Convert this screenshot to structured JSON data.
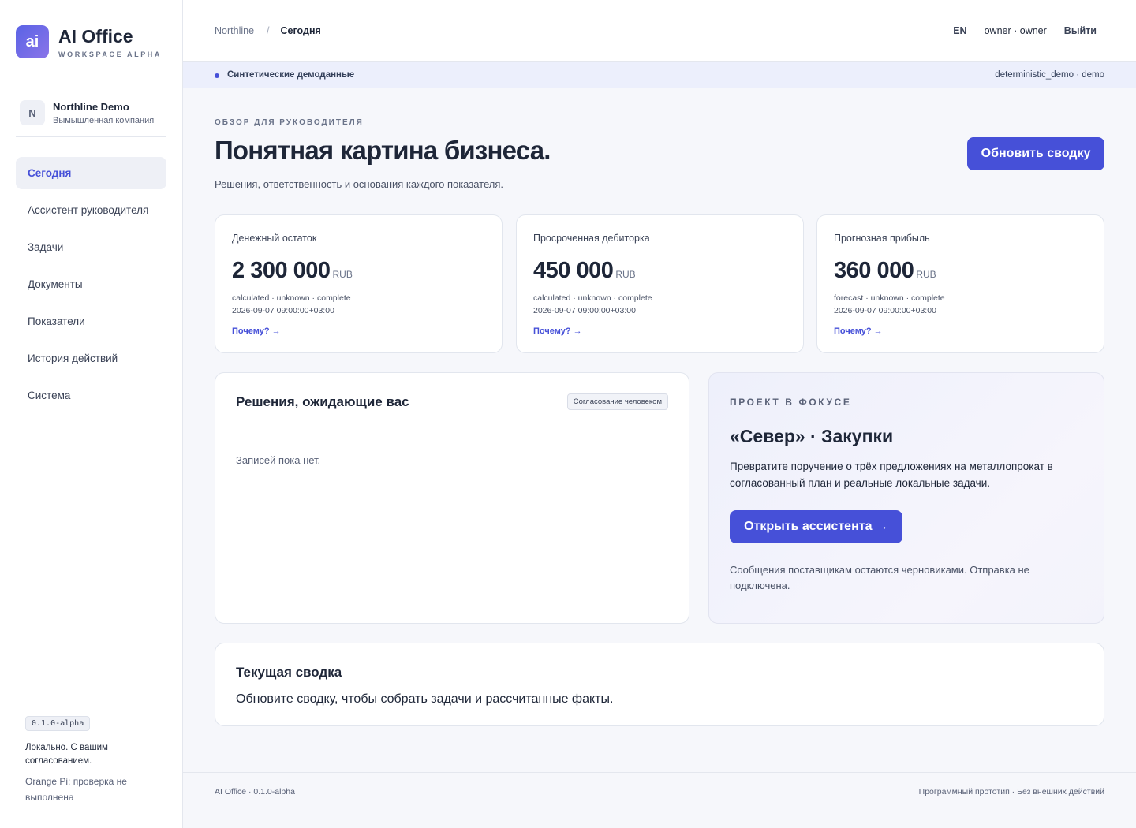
{
  "brand": {
    "logo": "ai",
    "title": "AI Office",
    "subtitle": "WORKSPACE ALPHA"
  },
  "company": {
    "initial": "N",
    "name": "Northline Demo",
    "subtitle": "Вымышленная компания"
  },
  "sidebar": {
    "items": [
      {
        "label": "Сегодня",
        "active": true
      },
      {
        "label": "Ассистент руководителя"
      },
      {
        "label": "Задачи"
      },
      {
        "label": "Документы"
      },
      {
        "label": "Показатели"
      },
      {
        "label": "История действий"
      },
      {
        "label": "Система"
      }
    ],
    "version": "0.1.0-alpha",
    "note": "Локально. С вашим согласованием.",
    "device_status": "Orange Pi: проверка не выполнена"
  },
  "breadcrumb": {
    "root": "Northline",
    "separator": "/",
    "current": "Сегодня"
  },
  "topbar": {
    "lang": "EN",
    "user": "owner · owner",
    "logout": "Выйти"
  },
  "banner": {
    "left": "Синтетические демоданные",
    "right": "deterministic_demo · demo"
  },
  "header": {
    "eyebrow": "ОБЗОР ДЛЯ РУКОВОДИТЕЛЯ",
    "title": "Понятная картина бизнеса.",
    "subtitle": "Решения, ответственность и основания каждого показателя.",
    "refresh_label": "Обновить сводку"
  },
  "kpis": [
    {
      "label": "Денежный остаток",
      "value": "2 300 000",
      "unit": "RUB",
      "meta": "calculated · unknown · complete",
      "timestamp": "2026-09-07 09:00:00+03:00",
      "link": "Почему? →"
    },
    {
      "label": "Просроченная дебиторка",
      "value": "450 000",
      "unit": "RUB",
      "meta": "calculated · unknown · complete",
      "timestamp": "2026-09-07 09:00:00+03:00",
      "link": "Почему? →"
    },
    {
      "label": "Прогнозная прибыль",
      "value": "360 000",
      "unit": "RUB",
      "meta": "forecast · unknown · complete",
      "timestamp": "2026-09-07 09:00:00+03:00",
      "link": "Почему? →"
    }
  ],
  "decisions": {
    "title": "Решения, ожидающие вас",
    "badge": "Согласование человеком",
    "empty": "Записей пока нет."
  },
  "focus": {
    "eyebrow": "ПРОЕКТ В ФОКУСЕ",
    "title": "«Север» · Закупки",
    "description": "Превратите поручение о трёх предложениях на металлопрокат в согласованный план и реальные локальные задачи.",
    "button": "Открыть ассистента →",
    "note": "Сообщения поставщикам остаются черновиками. Отправка не подключена."
  },
  "summary": {
    "title": "Текущая сводка",
    "text": "Обновите сводку, чтобы собрать задачи и рассчитанные факты."
  },
  "footer": {
    "left": "AI Office · 0.1.0-alpha",
    "right": "Программный прототип · Без внешних действий"
  }
}
